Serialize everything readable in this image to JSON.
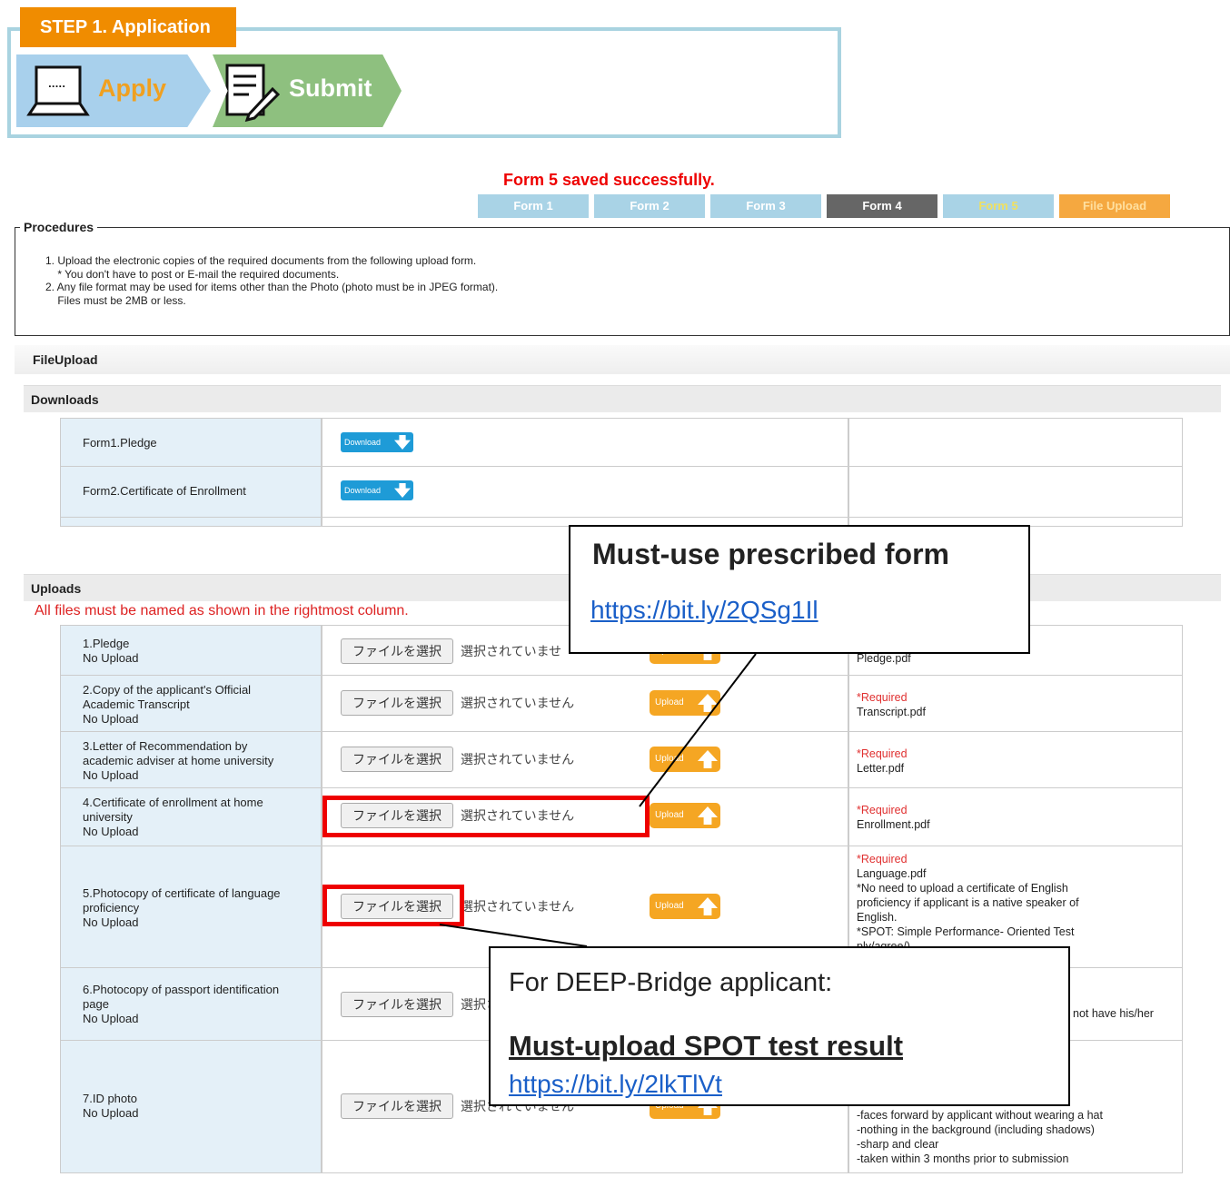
{
  "step": {
    "tag": "STEP 1. Application",
    "apply": "Apply",
    "submit": "Submit"
  },
  "nav": {
    "saved_message": "Form 5 saved successfully.",
    "tabs": [
      "Form 1",
      "Form 2",
      "Form 3",
      "Form 4",
      "Form 5",
      "File Upload"
    ]
  },
  "procedures": {
    "legend": "Procedures",
    "lines": [
      "1. Upload the electronic copies of the required documents from the following upload form.",
      "    * You don't have to post or E-mail the required documents.",
      "2. Any file format may be used for items other than the Photo (photo must be in JPEG format).",
      "    Files must be 2MB or less."
    ]
  },
  "fileupload_title": "FileUpload",
  "downloads": {
    "title": "Downloads",
    "button_label": "Download",
    "items": [
      "Form1.Pledge",
      "Form2.Certificate of Enrollment"
    ]
  },
  "uploads": {
    "title": "Uploads",
    "notice": "All files must be named as shown in the rightmost column.",
    "choose_label": "ファイルを選択",
    "no_file": "選択されていません",
    "no_file_partial": "選択されていませ",
    "upload_label": "Upload",
    "rows": [
      {
        "title": "1.Pledge",
        "status": "No Upload",
        "req": "",
        "notes": "Pledge.pdf"
      },
      {
        "title": "2.Copy of the applicant's Official\nAcademic Transcript",
        "status": "No Upload",
        "req": "*Required",
        "notes": "Transcript.pdf"
      },
      {
        "title": "3.Letter of Recommendation by\nacademic adviser at home university",
        "status": "No Upload",
        "req": "*Required",
        "notes": "Letter.pdf"
      },
      {
        "title": "4.Certificate of enrollment at home\nuniversity",
        "status": "No Upload",
        "req": "*Required",
        "notes": "Enrollment.pdf"
      },
      {
        "title": "5.Photocopy of certificate of language\nproficiency",
        "status": "No Upload",
        "req": "*Required",
        "notes": "Language.pdf\n*No need to upload a certificate of English\nproficiency if applicant is a native speaker of\nEnglish.\n*SPOT: Simple Performance- Oriented Test\nply/agree/)"
      },
      {
        "title": "6.Photocopy of passport identification\npage",
        "status": "No Upload",
        "req": "",
        "notes": "not have his/her"
      },
      {
        "title": "7.ID photo",
        "status": "No Upload",
        "req": "",
        "notes": "-faces forward by applicant without wearing a hat\n-nothing in the background (including shadows)\n-sharp and clear\n-taken within 3 months prior to submission"
      }
    ]
  },
  "callouts": {
    "form": {
      "title": "Must-use prescribed form",
      "link": "https://bit.ly/2QSg1Il"
    },
    "spot": {
      "line1": "For DEEP-Bridge applicant:",
      "line2": "Must-upload SPOT test result",
      "link": "https://bit.ly/2lkTlVt"
    }
  }
}
